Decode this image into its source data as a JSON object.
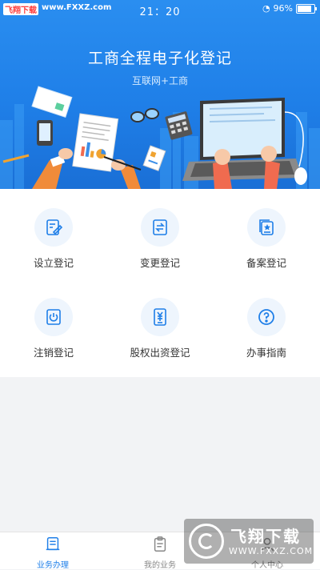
{
  "watermark": {
    "top_brand": "飞翔下载",
    "top_url": "www.FXXZ.com",
    "bottom_brand": "飞翔下载",
    "bottom_url": "WWW.FXXZ.COM"
  },
  "status_bar": {
    "time": "21：20",
    "battery": "96%",
    "battery_level": 0.96
  },
  "banner": {
    "title": "工商全程电子化登记",
    "subtitle": "互联网+工商"
  },
  "services": [
    {
      "label": "设立登记",
      "icon": "edit-document-icon"
    },
    {
      "label": "变更登记",
      "icon": "change-document-icon"
    },
    {
      "label": "备案登记",
      "icon": "filing-star-icon"
    },
    {
      "label": "注销登记",
      "icon": "cancel-power-icon"
    },
    {
      "label": "股权出资登记",
      "icon": "equity-yuan-icon"
    },
    {
      "label": "办事指南",
      "icon": "question-icon"
    }
  ],
  "tabbar": {
    "tabs": [
      {
        "label": "业务办理",
        "icon": "business-icon",
        "active": true
      },
      {
        "label": "我的业务",
        "icon": "clipboard-icon",
        "active": false
      },
      {
        "label": "个人中心",
        "icon": "person-icon",
        "active": false
      }
    ]
  },
  "colors": {
    "accent": "#1f7fe8",
    "icon_bg": "#eef5fd",
    "page_bg": "#f2f3f5"
  }
}
